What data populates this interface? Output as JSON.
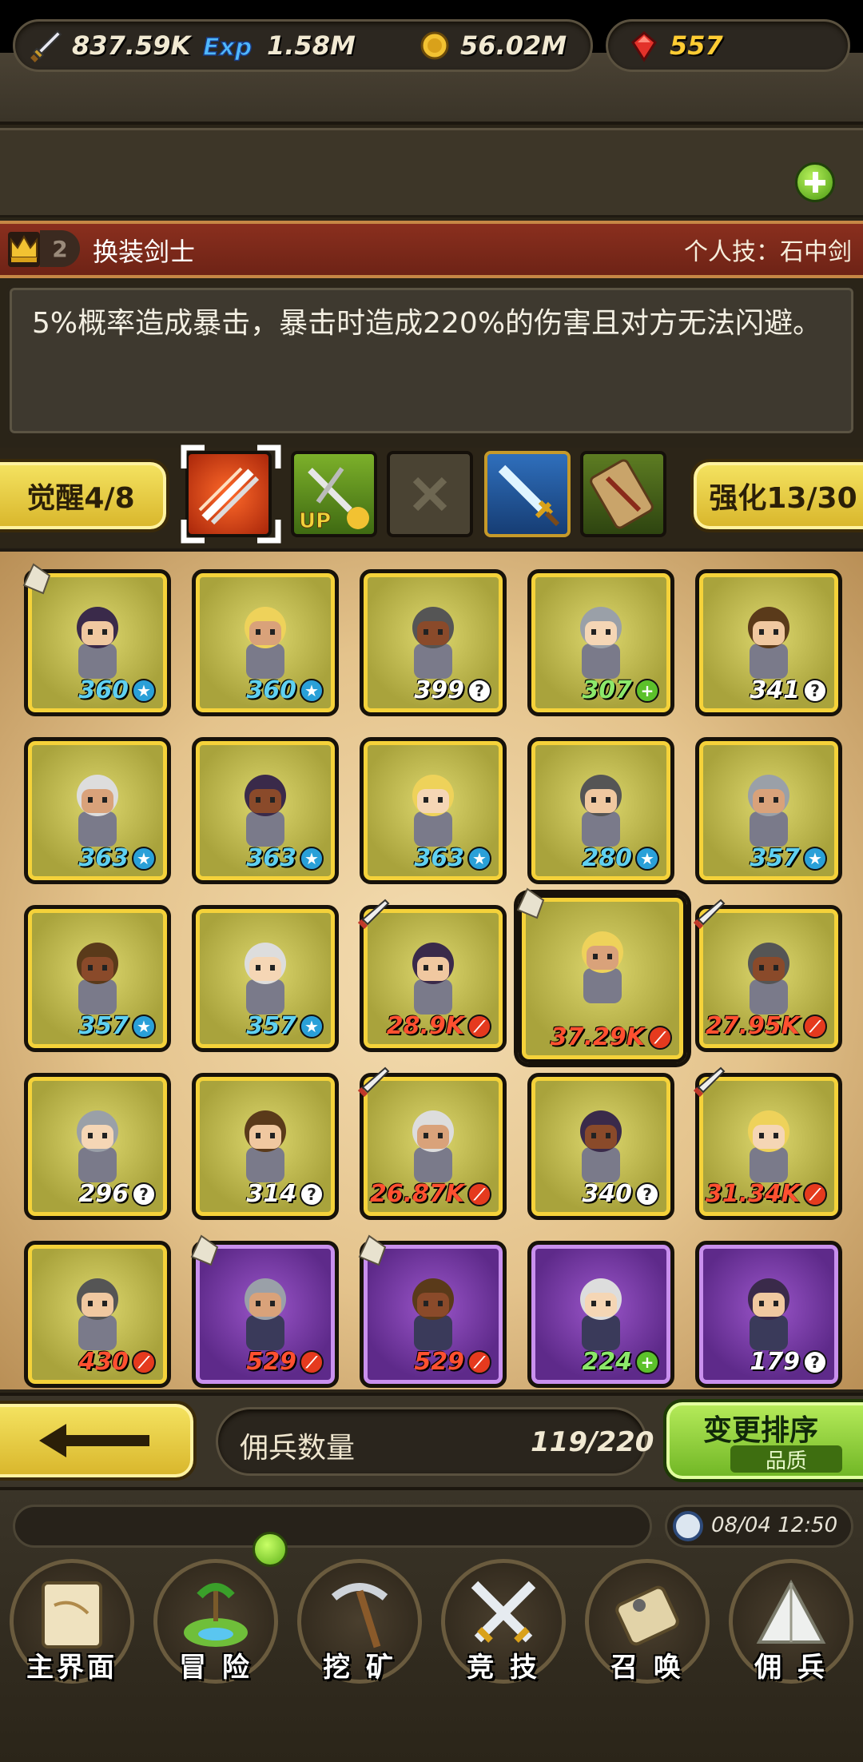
{
  "resources": {
    "attack": "837.59K",
    "exp": "1.58M",
    "gold": "56.02M",
    "gems": "557"
  },
  "hero": {
    "rank": "2",
    "name": "换装剑士",
    "skill": "个人技：石中剑",
    "description": "5%概率造成暴击，暴击时造成220%的伤害且对方无法闪避。"
  },
  "tabs": {
    "awaken": "觉醒4/8",
    "enhance": "强化13/30"
  },
  "mercenaries": [
    {
      "level": "360",
      "badge": "star",
      "color": "blue",
      "frame": "gold",
      "mark": true
    },
    {
      "level": "360",
      "badge": "star",
      "color": "blue",
      "frame": "gold"
    },
    {
      "level": "399",
      "badge": "q",
      "color": "white",
      "frame": "gold"
    },
    {
      "level": "307",
      "badge": "plus",
      "color": "green",
      "frame": "gold"
    },
    {
      "level": "341",
      "badge": "q",
      "color": "white",
      "frame": "gold"
    },
    {
      "level": "363",
      "badge": "star",
      "color": "blue",
      "frame": "gold"
    },
    {
      "level": "363",
      "badge": "star",
      "color": "blue",
      "frame": "gold"
    },
    {
      "level": "363",
      "badge": "star",
      "color": "blue",
      "frame": "gold"
    },
    {
      "level": "280",
      "badge": "star",
      "color": "blue",
      "frame": "gold"
    },
    {
      "level": "357",
      "badge": "star",
      "color": "blue",
      "frame": "gold"
    },
    {
      "level": "357",
      "badge": "star",
      "color": "blue",
      "frame": "gold"
    },
    {
      "level": "357",
      "badge": "star",
      "color": "blue",
      "frame": "gold"
    },
    {
      "level": "28.9K",
      "badge": "swd",
      "color": "red",
      "frame": "gold",
      "sword": true
    },
    {
      "level": "37.29K",
      "badge": "swd",
      "color": "red",
      "frame": "gold",
      "mark": true,
      "selected": true
    },
    {
      "level": "27.95K",
      "badge": "swd",
      "color": "red",
      "frame": "gold",
      "sword": true
    },
    {
      "level": "296",
      "badge": "q",
      "color": "white",
      "frame": "gold"
    },
    {
      "level": "314",
      "badge": "q",
      "color": "white",
      "frame": "gold"
    },
    {
      "level": "26.87K",
      "badge": "swd",
      "color": "red",
      "frame": "gold",
      "sword": true
    },
    {
      "level": "340",
      "badge": "q",
      "color": "white",
      "frame": "gold"
    },
    {
      "level": "31.34K",
      "badge": "swd",
      "color": "red",
      "frame": "gold",
      "sword": true
    },
    {
      "level": "430",
      "badge": "swd",
      "color": "red",
      "frame": "gold"
    },
    {
      "level": "529",
      "badge": "swd",
      "color": "red",
      "frame": "purple",
      "mark": true
    },
    {
      "level": "529",
      "badge": "swd",
      "color": "red",
      "frame": "purple",
      "mark": true
    },
    {
      "level": "224",
      "badge": "plus",
      "color": "green",
      "frame": "purple"
    },
    {
      "level": "179",
      "badge": "q",
      "color": "white",
      "frame": "purple"
    }
  ],
  "footer": {
    "count_label": "佣兵数量",
    "count_value": "119/220",
    "sort_label": "变更排序",
    "sort_sub": "品质"
  },
  "status": {
    "time": "08/04 12:50"
  },
  "nav": [
    {
      "label": "主界面",
      "icon": "map-scroll-icon"
    },
    {
      "label": "冒 险",
      "icon": "island-icon"
    },
    {
      "label": "挖 矿",
      "icon": "pickaxe-icon"
    },
    {
      "label": "竞 技",
      "icon": "crossed-swords-icon"
    },
    {
      "label": "召 唤",
      "icon": "summon-scroll-icon"
    },
    {
      "label": "佣 兵",
      "icon": "tent-icon"
    }
  ]
}
